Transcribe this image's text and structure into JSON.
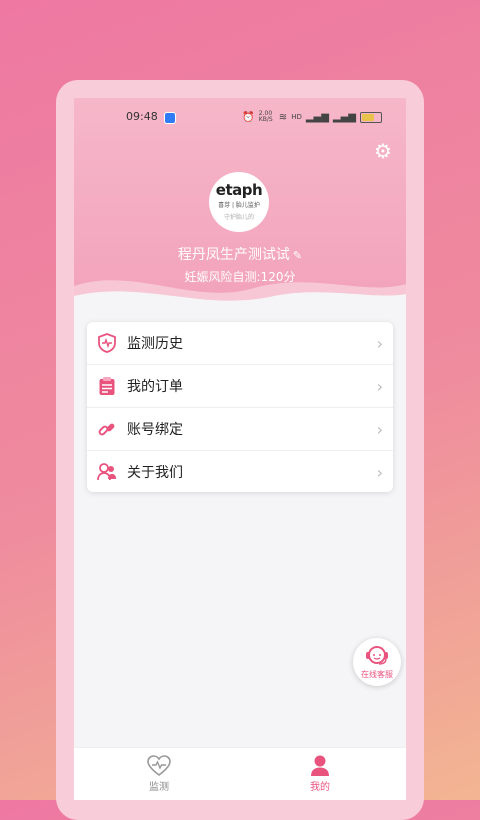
{
  "status_bar": {
    "time": "09:48",
    "speed": "2.00 KB/S",
    "battery": "44"
  },
  "profile": {
    "avatar_logo": "etaph",
    "avatar_sub1": "喜芽 | 胎儿监护",
    "avatar_sub2": "守护胎儿的",
    "name": "程丹凤生产测试试",
    "risk_score": "妊娠风险自测:120分"
  },
  "menu": {
    "items": [
      {
        "label": "监测历史",
        "icon": "shield-heart-icon"
      },
      {
        "label": "我的订单",
        "icon": "clipboard-icon"
      },
      {
        "label": "账号绑定",
        "icon": "link-icon"
      },
      {
        "label": "关于我们",
        "icon": "people-icon"
      }
    ]
  },
  "customer_service": {
    "label": "在线客服"
  },
  "tabbar": {
    "tabs": [
      {
        "label": "监测",
        "icon": "heart-pulse-icon",
        "active": false
      },
      {
        "label": "我的",
        "icon": "person-icon",
        "active": true
      }
    ]
  },
  "colors": {
    "accent": "#e9547f",
    "header_pink": "#f4aec3"
  }
}
